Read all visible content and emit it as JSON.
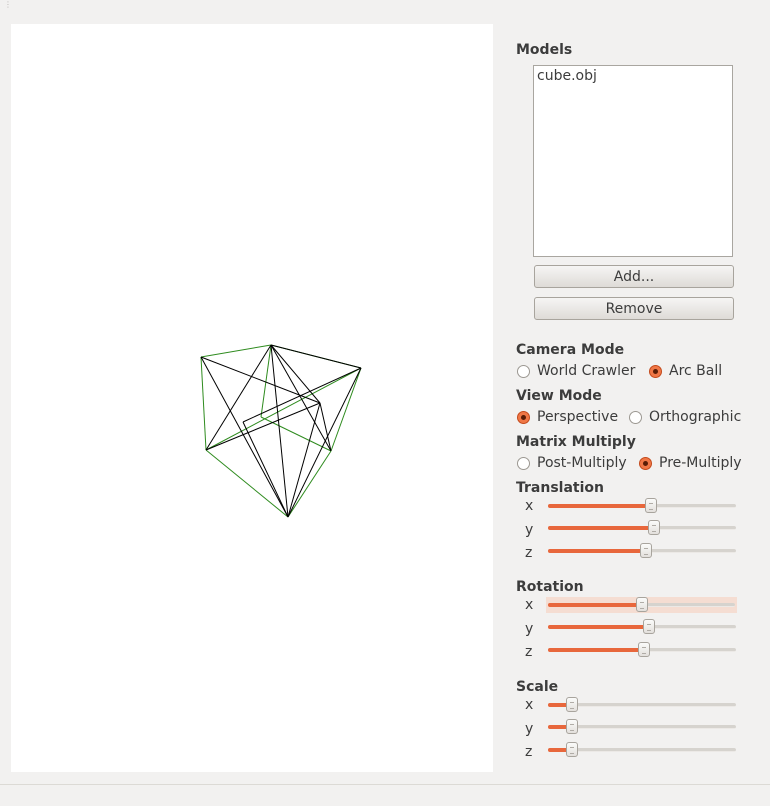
{
  "models": {
    "title": "Models",
    "items": [
      "cube.obj"
    ],
    "add_label": "Add...",
    "remove_label": "Remove"
  },
  "camera_mode": {
    "title": "Camera Mode",
    "options": [
      {
        "label": "World Crawler",
        "checked": false
      },
      {
        "label": "Arc Ball",
        "checked": true
      }
    ]
  },
  "view_mode": {
    "title": "View Mode",
    "options": [
      {
        "label": "Perspective",
        "checked": true
      },
      {
        "label": "Orthographic",
        "checked": false
      }
    ]
  },
  "matrix_multiply": {
    "title": "Matrix Multiply",
    "options": [
      {
        "label": "Post-Multiply",
        "checked": false
      },
      {
        "label": "Pre-Multiply",
        "checked": true
      }
    ]
  },
  "translation": {
    "title": "Translation",
    "sliders": [
      {
        "axis": "x",
        "value": 0.55
      },
      {
        "axis": "y",
        "value": 0.57
      },
      {
        "axis": "z",
        "value": 0.52
      }
    ]
  },
  "rotation": {
    "title": "Rotation",
    "sliders": [
      {
        "axis": "x",
        "value": 0.5
      },
      {
        "axis": "y",
        "value": 0.54
      },
      {
        "axis": "z",
        "value": 0.51
      }
    ]
  },
  "scale": {
    "title": "Scale",
    "sliders": [
      {
        "axis": "x",
        "value": 0.1
      },
      {
        "axis": "y",
        "value": 0.1
      },
      {
        "axis": "z",
        "value": 0.1
      }
    ]
  },
  "colors": {
    "accent": "#e8673c",
    "wire_black": "#000000",
    "wire_green": "#2e8b1e"
  }
}
